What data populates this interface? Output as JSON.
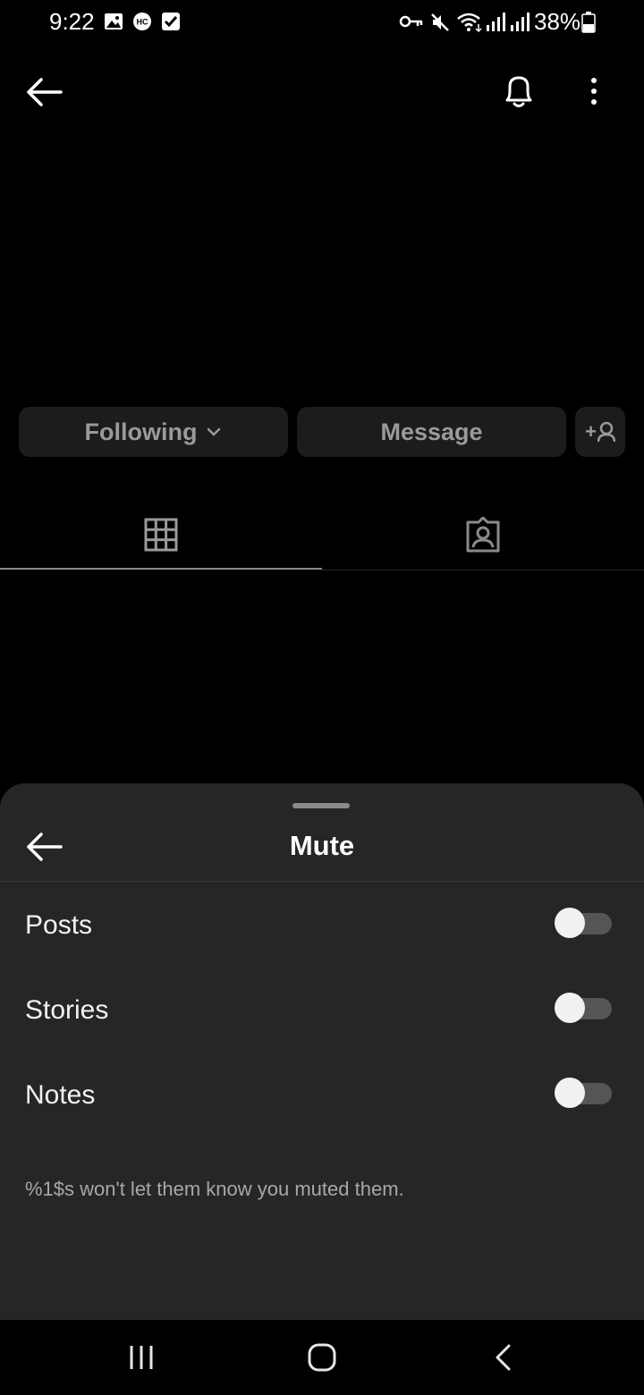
{
  "status_bar": {
    "time": "9:22",
    "battery": "38%",
    "left_icons": [
      "image-icon",
      "hc-badge-icon",
      "checkbox-icon"
    ],
    "hc_badge": "HC",
    "right_icons": [
      "vpn-key-icon",
      "mute-icon",
      "wifi-icon",
      "signal-icon",
      "signal-icon",
      "battery-icon"
    ]
  },
  "top_nav": {
    "icons": [
      "back-arrow-icon",
      "bell-icon",
      "more-vertical-icon"
    ]
  },
  "profile_actions": {
    "following_label": "Following",
    "message_label": "Message",
    "add_person_label": "+"
  },
  "tabs": [
    {
      "icon": "grid-icon",
      "selected": true
    },
    {
      "icon": "tagged-person-icon",
      "selected": false
    }
  ],
  "mute_sheet": {
    "title": "Mute",
    "options": [
      {
        "label": "Posts",
        "enabled": false
      },
      {
        "label": "Stories",
        "enabled": false
      },
      {
        "label": "Notes",
        "enabled": false
      }
    ],
    "note": "%1$s won't let them know you muted them."
  },
  "system_nav": {
    "icons": [
      "recent-apps-icon",
      "home-icon",
      "back-icon"
    ]
  },
  "colors": {
    "background": "#000000",
    "sheet": "#262626",
    "button": "#1c1c1c",
    "muted_text": "#9a9a9a",
    "toggle_track_off": "#555555",
    "toggle_thumb": "#f1f1f1"
  }
}
